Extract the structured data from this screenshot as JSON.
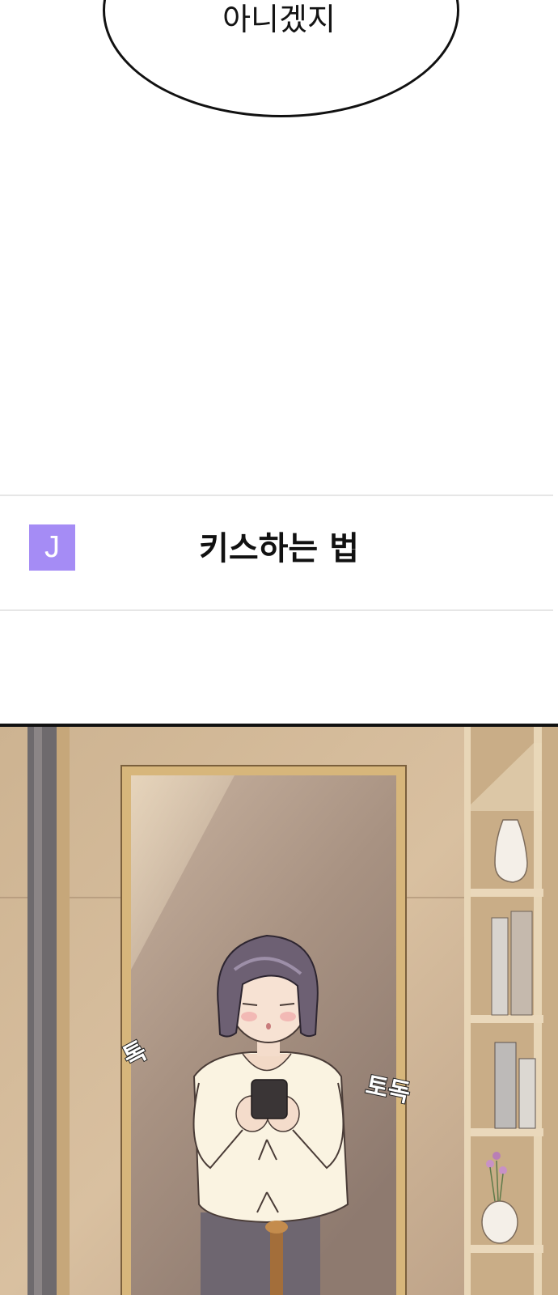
{
  "bubble": {
    "text": "아니겠지"
  },
  "search_card": {
    "avatar_letter": "J",
    "query": "키스하는 법"
  },
  "panel": {
    "sfx_left": "톡",
    "sfx_right": "토독",
    "colors": {
      "wall": "#d8bf9e",
      "mirror": "#b9a290",
      "frame": "#d9b97f",
      "shelf": "#ead8bb"
    }
  }
}
